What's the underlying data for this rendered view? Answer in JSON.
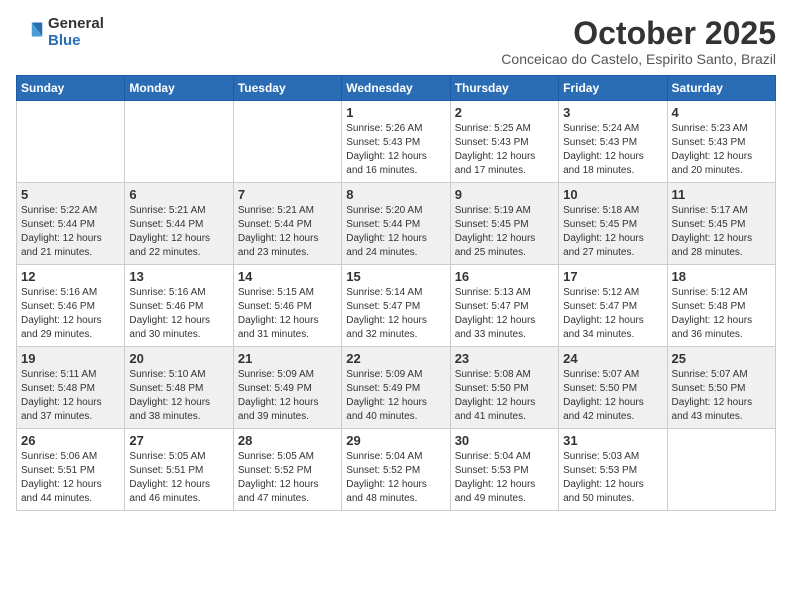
{
  "logo": {
    "general": "General",
    "blue": "Blue"
  },
  "title": "October 2025",
  "location": "Conceicao do Castelo, Espirito Santo, Brazil",
  "weekdays": [
    "Sunday",
    "Monday",
    "Tuesday",
    "Wednesday",
    "Thursday",
    "Friday",
    "Saturday"
  ],
  "weeks": [
    [
      {
        "day": "",
        "info": ""
      },
      {
        "day": "",
        "info": ""
      },
      {
        "day": "",
        "info": ""
      },
      {
        "day": "1",
        "info": "Sunrise: 5:26 AM\nSunset: 5:43 PM\nDaylight: 12 hours\nand 16 minutes."
      },
      {
        "day": "2",
        "info": "Sunrise: 5:25 AM\nSunset: 5:43 PM\nDaylight: 12 hours\nand 17 minutes."
      },
      {
        "day": "3",
        "info": "Sunrise: 5:24 AM\nSunset: 5:43 PM\nDaylight: 12 hours\nand 18 minutes."
      },
      {
        "day": "4",
        "info": "Sunrise: 5:23 AM\nSunset: 5:43 PM\nDaylight: 12 hours\nand 20 minutes."
      }
    ],
    [
      {
        "day": "5",
        "info": "Sunrise: 5:22 AM\nSunset: 5:44 PM\nDaylight: 12 hours\nand 21 minutes."
      },
      {
        "day": "6",
        "info": "Sunrise: 5:21 AM\nSunset: 5:44 PM\nDaylight: 12 hours\nand 22 minutes."
      },
      {
        "day": "7",
        "info": "Sunrise: 5:21 AM\nSunset: 5:44 PM\nDaylight: 12 hours\nand 23 minutes."
      },
      {
        "day": "8",
        "info": "Sunrise: 5:20 AM\nSunset: 5:44 PM\nDaylight: 12 hours\nand 24 minutes."
      },
      {
        "day": "9",
        "info": "Sunrise: 5:19 AM\nSunset: 5:45 PM\nDaylight: 12 hours\nand 25 minutes."
      },
      {
        "day": "10",
        "info": "Sunrise: 5:18 AM\nSunset: 5:45 PM\nDaylight: 12 hours\nand 27 minutes."
      },
      {
        "day": "11",
        "info": "Sunrise: 5:17 AM\nSunset: 5:45 PM\nDaylight: 12 hours\nand 28 minutes."
      }
    ],
    [
      {
        "day": "12",
        "info": "Sunrise: 5:16 AM\nSunset: 5:46 PM\nDaylight: 12 hours\nand 29 minutes."
      },
      {
        "day": "13",
        "info": "Sunrise: 5:16 AM\nSunset: 5:46 PM\nDaylight: 12 hours\nand 30 minutes."
      },
      {
        "day": "14",
        "info": "Sunrise: 5:15 AM\nSunset: 5:46 PM\nDaylight: 12 hours\nand 31 minutes."
      },
      {
        "day": "15",
        "info": "Sunrise: 5:14 AM\nSunset: 5:47 PM\nDaylight: 12 hours\nand 32 minutes."
      },
      {
        "day": "16",
        "info": "Sunrise: 5:13 AM\nSunset: 5:47 PM\nDaylight: 12 hours\nand 33 minutes."
      },
      {
        "day": "17",
        "info": "Sunrise: 5:12 AM\nSunset: 5:47 PM\nDaylight: 12 hours\nand 34 minutes."
      },
      {
        "day": "18",
        "info": "Sunrise: 5:12 AM\nSunset: 5:48 PM\nDaylight: 12 hours\nand 36 minutes."
      }
    ],
    [
      {
        "day": "19",
        "info": "Sunrise: 5:11 AM\nSunset: 5:48 PM\nDaylight: 12 hours\nand 37 minutes."
      },
      {
        "day": "20",
        "info": "Sunrise: 5:10 AM\nSunset: 5:48 PM\nDaylight: 12 hours\nand 38 minutes."
      },
      {
        "day": "21",
        "info": "Sunrise: 5:09 AM\nSunset: 5:49 PM\nDaylight: 12 hours\nand 39 minutes."
      },
      {
        "day": "22",
        "info": "Sunrise: 5:09 AM\nSunset: 5:49 PM\nDaylight: 12 hours\nand 40 minutes."
      },
      {
        "day": "23",
        "info": "Sunrise: 5:08 AM\nSunset: 5:50 PM\nDaylight: 12 hours\nand 41 minutes."
      },
      {
        "day": "24",
        "info": "Sunrise: 5:07 AM\nSunset: 5:50 PM\nDaylight: 12 hours\nand 42 minutes."
      },
      {
        "day": "25",
        "info": "Sunrise: 5:07 AM\nSunset: 5:50 PM\nDaylight: 12 hours\nand 43 minutes."
      }
    ],
    [
      {
        "day": "26",
        "info": "Sunrise: 5:06 AM\nSunset: 5:51 PM\nDaylight: 12 hours\nand 44 minutes."
      },
      {
        "day": "27",
        "info": "Sunrise: 5:05 AM\nSunset: 5:51 PM\nDaylight: 12 hours\nand 46 minutes."
      },
      {
        "day": "28",
        "info": "Sunrise: 5:05 AM\nSunset: 5:52 PM\nDaylight: 12 hours\nand 47 minutes."
      },
      {
        "day": "29",
        "info": "Sunrise: 5:04 AM\nSunset: 5:52 PM\nDaylight: 12 hours\nand 48 minutes."
      },
      {
        "day": "30",
        "info": "Sunrise: 5:04 AM\nSunset: 5:53 PM\nDaylight: 12 hours\nand 49 minutes."
      },
      {
        "day": "31",
        "info": "Sunrise: 5:03 AM\nSunset: 5:53 PM\nDaylight: 12 hours\nand 50 minutes."
      },
      {
        "day": "",
        "info": ""
      }
    ]
  ]
}
